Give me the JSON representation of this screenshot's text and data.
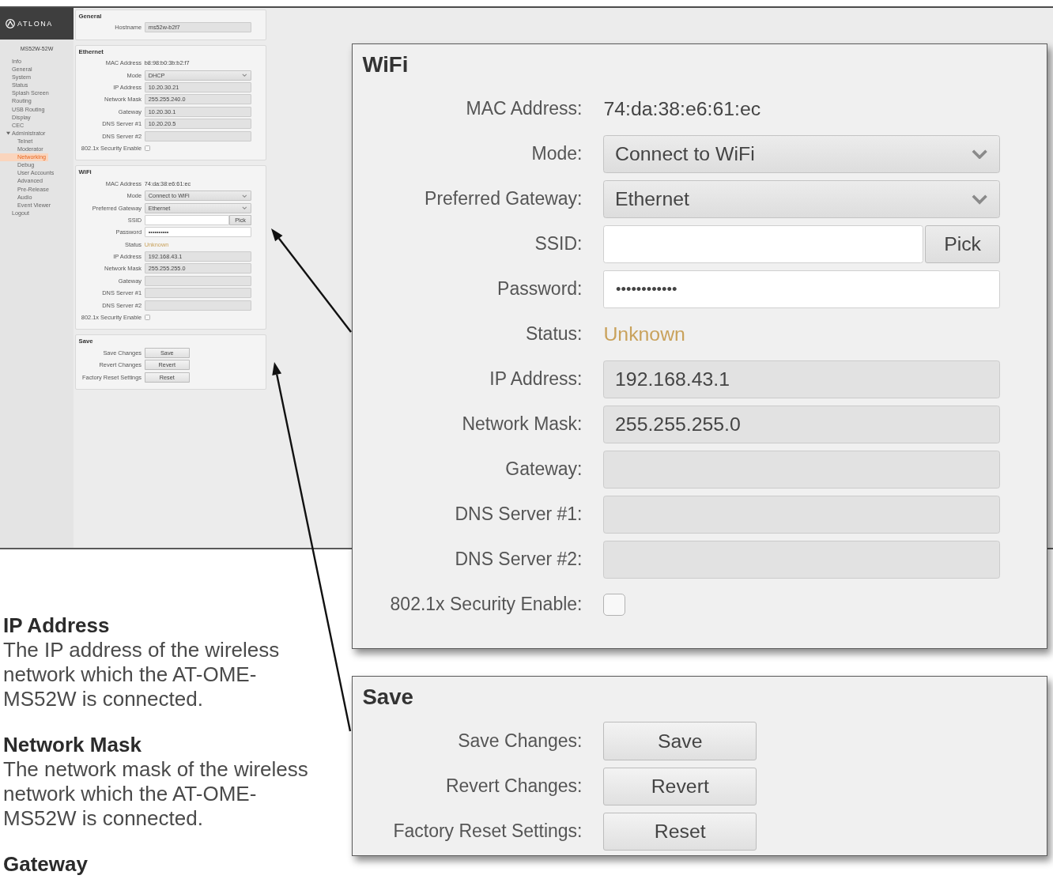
{
  "screenshot": {
    "sidebar": {
      "logo": "ATLONA",
      "device_name": "MS52W-52W",
      "items": [
        {
          "label": "Info",
          "selected": false
        },
        {
          "label": "General",
          "selected": false
        },
        {
          "label": "System",
          "selected": false
        },
        {
          "label": "Status",
          "selected": false
        },
        {
          "label": "Splash Screen",
          "selected": false
        },
        {
          "label": "Routing",
          "selected": false
        },
        {
          "label": "USB Routing",
          "selected": false
        },
        {
          "label": "Display",
          "selected": false
        },
        {
          "label": "CEC",
          "selected": false
        },
        {
          "label": "Administrator",
          "selected": false,
          "expanded": true,
          "children": [
            {
              "label": "Telnet",
              "selected": false
            },
            {
              "label": "Moderator",
              "selected": false
            },
            {
              "label": "Networking",
              "selected": true
            },
            {
              "label": "Debug",
              "selected": false
            },
            {
              "label": "User Accounts",
              "selected": false
            },
            {
              "label": "Advanced",
              "selected": false
            },
            {
              "label": "Pre-Release",
              "selected": false
            },
            {
              "label": "Audio",
              "selected": false
            },
            {
              "label": "Event Viewer",
              "selected": false
            }
          ]
        },
        {
          "label": "Logout",
          "selected": false
        }
      ]
    },
    "panels": [
      {
        "title": "General",
        "rows": [
          {
            "kind": "readonly",
            "label": "Hostname",
            "value": "ms52w-b2f7"
          }
        ]
      },
      {
        "title": "Ethernet",
        "rows": [
          {
            "kind": "text",
            "label": "MAC Address",
            "value": "b8:98:b0:3b:b2:f7"
          },
          {
            "kind": "select",
            "label": "Mode",
            "value": "DHCP"
          },
          {
            "kind": "readonly",
            "label": "IP Address",
            "value": "10.20.30.21"
          },
          {
            "kind": "readonly",
            "label": "Network Mask",
            "value": "255.255.240.0"
          },
          {
            "kind": "readonly",
            "label": "Gateway",
            "value": "10.20.30.1"
          },
          {
            "kind": "readonly",
            "label": "DNS Server #1",
            "value": "10.20.20.5"
          },
          {
            "kind": "readonly",
            "label": "DNS Server #2"
          },
          {
            "kind": "checkbox",
            "label": "802.1x Security Enable",
            "checked": false
          }
        ]
      },
      {
        "title": "WiFi",
        "rows": [
          {
            "kind": "text",
            "label": "MAC Address",
            "value": "74:da:38:e6:61:ec"
          },
          {
            "kind": "select",
            "label": "Mode",
            "value": "Connect to WiFi"
          },
          {
            "kind": "select",
            "label": "Preferred Gateway",
            "value": "Ethernet"
          },
          {
            "kind": "input_button",
            "label": "SSID",
            "button": "Pick"
          },
          {
            "kind": "password",
            "label": "Password",
            "value": "••••••••••"
          },
          {
            "kind": "status",
            "label": "Status",
            "value": "Unknown"
          },
          {
            "kind": "readonly",
            "label": "IP Address",
            "value": "192.168.43.1"
          },
          {
            "kind": "readonly",
            "label": "Network Mask",
            "value": "255.255.255.0"
          },
          {
            "kind": "readonly",
            "label": "Gateway"
          },
          {
            "kind": "readonly",
            "label": "DNS Server #1"
          },
          {
            "kind": "readonly",
            "label": "DNS Server #2"
          },
          {
            "kind": "checkbox",
            "label": "802.1x Security Enable",
            "checked": false
          }
        ]
      },
      {
        "title": "Save",
        "rows": [
          {
            "kind": "button",
            "label": "Save Changes",
            "button": "Save"
          },
          {
            "kind": "button",
            "label": "Revert Changes",
            "button": "Revert"
          },
          {
            "kind": "button",
            "label": "Factory Reset Settings",
            "button": "Reset"
          }
        ]
      }
    ]
  },
  "callouts": [
    {
      "title": "WiFi",
      "rows": [
        {
          "kind": "text",
          "label": "MAC Address:",
          "value": "74:da:38:e6:61:ec"
        },
        {
          "kind": "select",
          "label": "Mode:",
          "value": "Connect to WiFi"
        },
        {
          "kind": "select",
          "label": "Preferred Gateway:",
          "value": "Ethernet"
        },
        {
          "kind": "input_button",
          "label": "SSID:",
          "button": "Pick"
        },
        {
          "kind": "password",
          "label": "Password:",
          "value": "••••••••••••"
        },
        {
          "kind": "status",
          "label": "Status:",
          "value": "Unknown"
        },
        {
          "kind": "readonly",
          "label": "IP Address:",
          "value": "192.168.43.1"
        },
        {
          "kind": "readonly",
          "label": "Network Mask:",
          "value": "255.255.255.0"
        },
        {
          "kind": "readonly",
          "label": "Gateway:"
        },
        {
          "kind": "readonly",
          "label": "DNS Server #1:"
        },
        {
          "kind": "readonly",
          "label": "DNS Server #2:"
        },
        {
          "kind": "checkbox",
          "label": "802.1x Security Enable:",
          "checked": false
        }
      ]
    },
    {
      "title": "Save",
      "rows": [
        {
          "kind": "button",
          "label": "Save Changes:",
          "button": "Save"
        },
        {
          "kind": "button",
          "label": "Revert Changes:",
          "button": "Revert"
        },
        {
          "kind": "button",
          "label": "Factory Reset Settings:",
          "button": "Reset"
        }
      ]
    }
  ],
  "descriptions": [
    {
      "heading": "IP Address",
      "text": "The IP address of the wireless network which the AT-OME-MS52W is connected."
    },
    {
      "heading": "Network Mask",
      "text": "The network mask of the wireless network which the AT-OME-MS52W is connected."
    },
    {
      "heading": "Gateway"
    }
  ]
}
